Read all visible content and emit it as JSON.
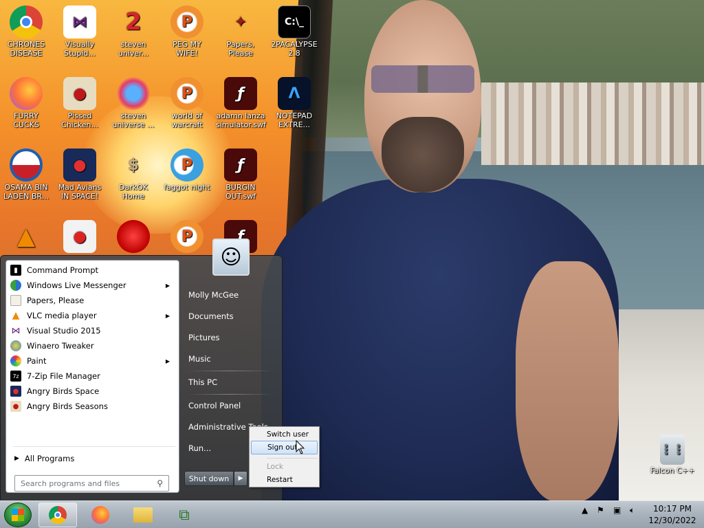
{
  "desktop_icons": [
    {
      "label": "CHRONES DISEASE",
      "icon": "chrome-icon"
    },
    {
      "label": "Visually Stupid...",
      "icon": "visual-studio-icon"
    },
    {
      "label": "steven univer...",
      "icon": "steven-universe-icon"
    },
    {
      "label": "PEG MY WIFE!",
      "icon": "peggle-icon"
    },
    {
      "label": "Papers, Please",
      "icon": "papers-please-icon"
    },
    {
      "label": "2PACALYPSE 2.8",
      "icon": "command-prompt-icon"
    },
    {
      "label": "FURRY CUCKS",
      "icon": "firefox-icon"
    },
    {
      "label": "Pissed Chicken...",
      "icon": "angry-birds-seasons-icon"
    },
    {
      "label": "steven universe ...",
      "icon": "steven-universe-gem-icon"
    },
    {
      "label": "world of warcraft",
      "icon": "peggle-icon"
    },
    {
      "label": "adamn lanza simulator.swf",
      "icon": "flash-icon"
    },
    {
      "label": "NOTEPAD EXTRE...",
      "icon": "notepad-icon"
    },
    {
      "label": "OSAMA BIN LADEN BR...",
      "icon": "obama-logo-icon"
    },
    {
      "label": "Mad Avians IN SPACE!",
      "icon": "angry-birds-space-icon"
    },
    {
      "label": "DarkOK Home",
      "icon": "money-bag-icon"
    },
    {
      "label": "faggot night",
      "icon": "peggle-nights-icon"
    },
    {
      "label": "BURGIN OUT.swf",
      "icon": "flash-icon"
    },
    {
      "label": "",
      "icon": "vlc-icon"
    },
    {
      "label": "",
      "icon": "angry-birds-icon"
    },
    {
      "label": "",
      "icon": "red-bird-icon"
    },
    {
      "label": "",
      "icon": "peggle-icon"
    },
    {
      "label": "",
      "icon": "flash-icon"
    }
  ],
  "recycle_bin": {
    "label": "Falcon C++"
  },
  "start_menu": {
    "programs": [
      {
        "label": "Command Prompt",
        "has_submenu": false
      },
      {
        "label": "Windows Live Messenger",
        "has_submenu": true
      },
      {
        "label": "Papers, Please",
        "has_submenu": false
      },
      {
        "label": "VLC media player",
        "has_submenu": true
      },
      {
        "label": "Visual Studio 2015",
        "has_submenu": false
      },
      {
        "label": "Winaero Tweaker",
        "has_submenu": false
      },
      {
        "label": "Paint",
        "has_submenu": true
      },
      {
        "label": "7-Zip File Manager",
        "has_submenu": false
      },
      {
        "label": "Angry Birds Space",
        "has_submenu": false
      },
      {
        "label": "Angry Birds Seasons",
        "has_submenu": false
      }
    ],
    "all_programs": "All Programs",
    "search_placeholder": "Search programs and files",
    "right_items": [
      "Molly McGee",
      "Documents",
      "Pictures",
      "Music",
      "This PC",
      "Control Panel",
      "Administrative Tools",
      "Run..."
    ],
    "shutdown_label": "Shut down"
  },
  "shutdown_menu": {
    "items": [
      "Switch user",
      "Sign out",
      "Lock",
      "Restart"
    ],
    "highlighted": "Sign out",
    "disabled": "Lock"
  },
  "taskbar": {
    "pinned": [
      "chrome-icon",
      "firefox-icon",
      "file-explorer-icon",
      "network-icon"
    ],
    "clock_time": "10:17 PM",
    "clock_date": "12/30/2022"
  }
}
